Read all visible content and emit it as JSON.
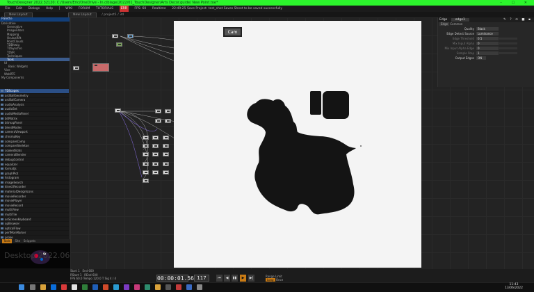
{
  "titlebar": {
    "title": "TouchDesigner 2022.32120: C:/Users/Eric/OneDrive - In.ciblage/2022/01_TouchDesigner/Arts Decor.guide/ New Point.toe*"
  },
  "menubar": {
    "items": [
      "File",
      "Edit",
      "Dialogs",
      "Help",
      "WIKI",
      "FORUM",
      "TUTORIALS"
    ],
    "badge": "ERR",
    "fps": "FPS: 60",
    "realtime": "Realtime",
    "status": "22:49:25 Save Project: test_shot Saves Sheet to be saved successfully"
  },
  "pathbar": {
    "tab": "New Layout",
    "tab2": "New Layout",
    "path": "/ project1 / 3d"
  },
  "palette": {
    "header": "Palette",
    "tree": [
      "Derivative",
      "Generative",
      "ImageFilters",
      "Mapping",
      "OculusRift",
      "PointClouds",
      "TDBitwig",
      "TDSynchro",
      "TDVR",
      "Techniques",
      "Tools",
      "UI",
      "Basic Widgets",
      "Vive",
      "WebRTC",
      "My Components"
    ],
    "selected_tree": "Tools",
    "list": [
      "TDScopes",
      "arcBallGeometry",
      "arcBallCamera",
      "audioAnalysis",
      "audioSet",
      "audioMediaPanel",
      "bitMatrix",
      "bitmapPanel",
      "blendModes",
      "cameraViewport",
      "chromaKey",
      "compareComp",
      "compareSkeleton",
      "cookedStats",
      "cameraBlender",
      "debugControl",
      "equalizer",
      "formatJs",
      "graphPlot",
      "histogram",
      "imageSearch",
      "kinectRecorder",
      "materialDesignIcons",
      "movieRecorder",
      "moviePlayer",
      "movieRecord",
      "multiView",
      "multiTile",
      "onScreenKeyboard",
      "opBrowser",
      "opticalFlow",
      "perfMonMarker",
      "probe",
      "remotePanel",
      "sceneChanger",
      "search",
      "searchReplace",
      "showCooks",
      "webRender",
      "widgetCache"
    ],
    "selected_list": "TDScopes",
    "tabs": [
      "Tools",
      "Site",
      "Snippets"
    ]
  },
  "network": {
    "cam_label": "Cam"
  },
  "params": {
    "op_type": "Edge",
    "op_name": "edge1",
    "tabs": [
      "Edge",
      "Common"
    ],
    "rows": [
      {
        "label": "Quality",
        "value": "Black"
      },
      {
        "label": "Edge Detect Source",
        "value": "Luminance"
      },
      {
        "label": "Edge Threshold",
        "value": "0.5"
      },
      {
        "label": "Mix Input Alpha",
        "value": "0"
      },
      {
        "label": "Mix Input Alpha Edge",
        "value": "0"
      },
      {
        "label": "Sample Step",
        "value": "1"
      },
      {
        "label": "Output Edges",
        "value": "ON"
      }
    ]
  },
  "timeline": {
    "start": "Start",
    "end": "End",
    "rstart": "RStart",
    "rend": "REnd",
    "start_v": "1",
    "end_v": "600",
    "rstart_v": "1",
    "rend_v": "600",
    "fps_label": "FPS",
    "fps_v": "60.0",
    "tempo_label": "Tempo",
    "tempo_v": "120.0",
    "sig": "T Sig",
    "sig_v": "4 / 4",
    "timecode": "00:00:01.56",
    "frame": "117",
    "range_limit": "Range Limit",
    "loop": "Loop",
    "once": "Once"
  },
  "desktop": {
    "watermark": "Desktop 2022.06.13 - 01.43.31.03"
  },
  "taskbar": {
    "time": "11:43",
    "date": "13/06/2022"
  }
}
